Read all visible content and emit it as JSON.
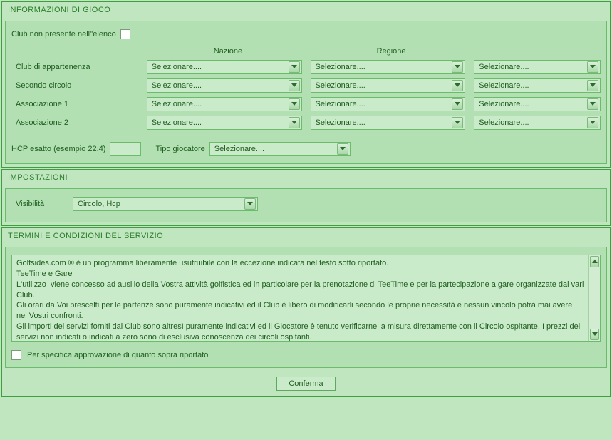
{
  "sections": {
    "game_info": "INFORMAZIONI DI GIOCO",
    "settings": "IMPOSTAZIONI",
    "terms": "TERMINI E CONDIZIONI DEL SERVIZIO"
  },
  "game": {
    "club_not_listed_label": "Club non presente nell''elenco",
    "headers": {
      "nazione": "Nazione",
      "regione": "Regione"
    },
    "rows": {
      "club": "Club di appartenenza",
      "secondo": "Secondo circolo",
      "assoc1": "Associazione 1",
      "assoc2": "Associazione 2"
    },
    "select_placeholder": "Selezionare....",
    "hcp_label": "HCP esatto (esempio 22.4)",
    "hcp_value": "",
    "player_type_label": "Tipo giocatore",
    "player_type_value": "Selezionare...."
  },
  "settings": {
    "visibility_label": "Visibilità",
    "visibility_value": "Circolo, Hcp"
  },
  "terms": {
    "text": "Golfsides.com ® è un programma liberamente usufruibile con la eccezione indicata nel testo sotto riportato.\nTeeTime e Gare\nL'utilizzo  viene concesso ad ausilio della Vostra attività golfistica ed in particolare per la prenotazione di TeeTime e per la partecipazione a gare organizzate dai vari Club.\nGli orari da Voi prescelti per le partenze sono puramente indicativi ed il Club è libero di modificarli secondo le proprie necessità e nessun vincolo potrà mai avere nei Vostri confronti.\nGli importi dei servizi forniti dai Club sono altresì puramente indicativi ed il Giocatore è tenuto verificarne la misura direttamente con il Circolo ospitante. I prezzi dei servizi non indicati o indicati a zero sono di esclusiva conoscenza dei circoli ospitanti.\nIl pagamento di importi delle prenotazioni con pagamento obbligatorio sono di esclusiva responsabilità del circolo il quale si è obbligato",
    "approve_label": "Per specifica approvazione di quanto sopra riportato"
  },
  "confirm_label": "Conferma"
}
